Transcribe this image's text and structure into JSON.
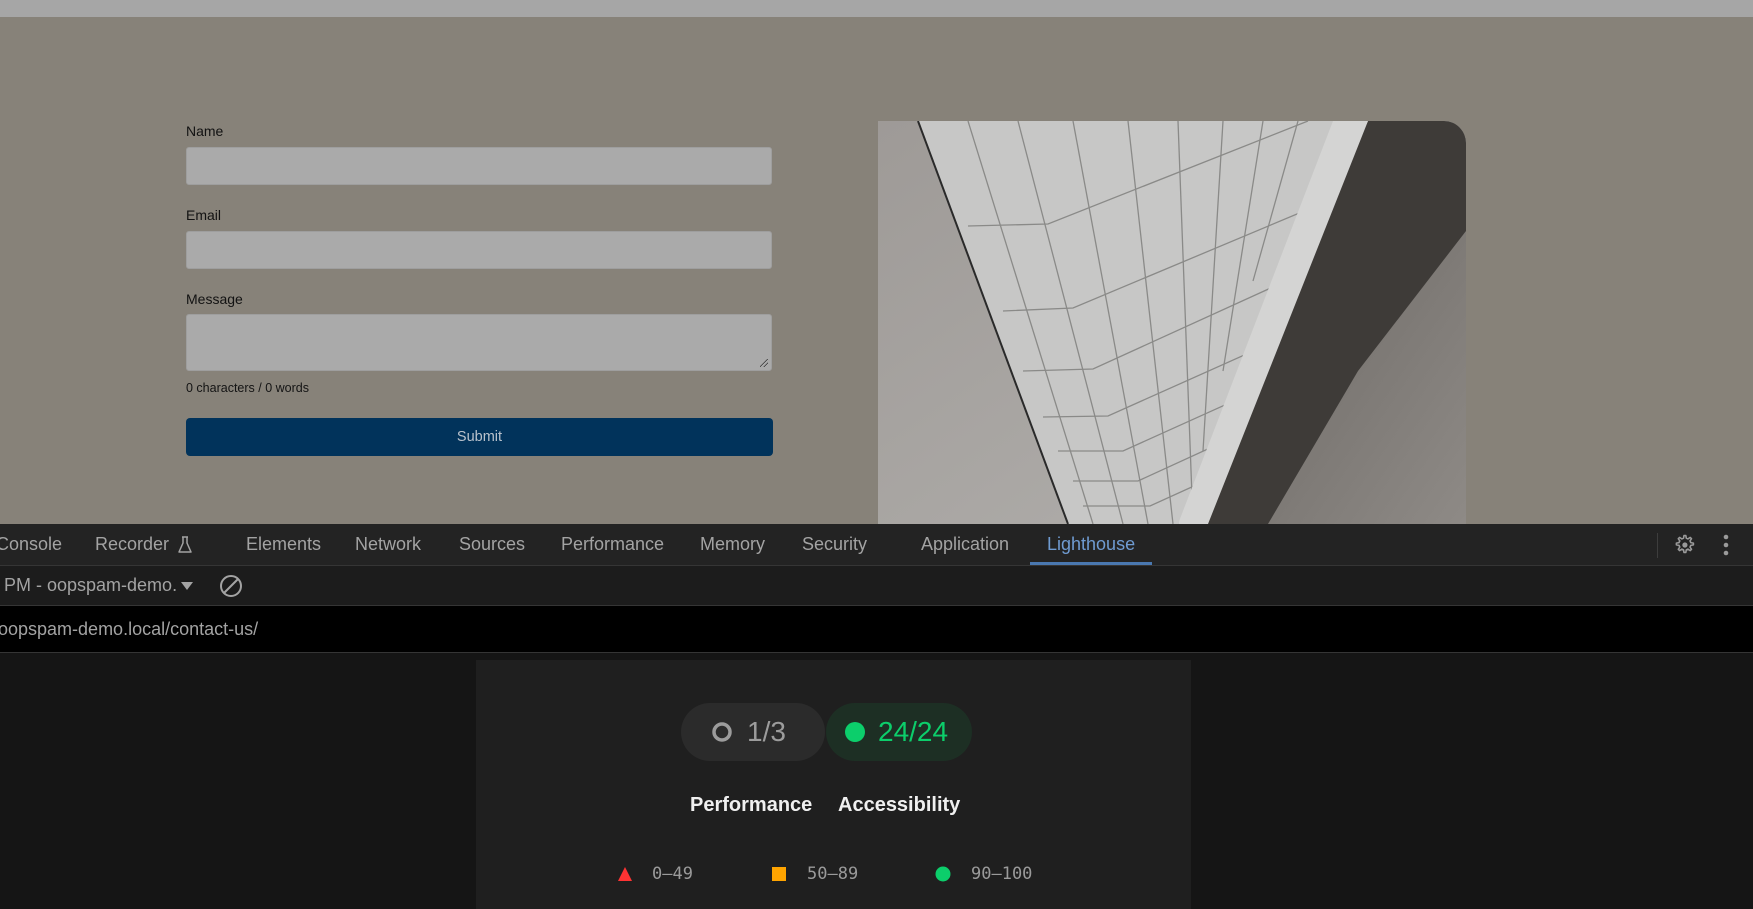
{
  "page": {
    "form": {
      "name_label": "Name",
      "name_value": "",
      "email_label": "Email",
      "email_value": "",
      "message_label": "Message",
      "message_value": "",
      "counter": "0 characters / 0 words",
      "submit_label": "Submit"
    },
    "image_alt": "Architectural skylight ceiling photo"
  },
  "devtools": {
    "tabs": [
      {
        "label": "Console"
      },
      {
        "label": "Recorder"
      },
      {
        "label": "Elements"
      },
      {
        "label": "Network"
      },
      {
        "label": "Sources"
      },
      {
        "label": "Performance"
      },
      {
        "label": "Memory"
      },
      {
        "label": "Security"
      },
      {
        "label": "Application"
      },
      {
        "label": "Lighthouse",
        "active": true
      }
    ],
    "toolbar": {
      "report_select": "PM - oopspam-demo.",
      "clear_icon": "block-icon"
    },
    "url": "oopspam-demo.local/contact-us/",
    "report": {
      "categories": [
        {
          "label": "Performance",
          "score": "1/3",
          "status": "neutral"
        },
        {
          "label": "Accessibility",
          "score": "24/24",
          "status": "pass"
        }
      ],
      "legend": [
        {
          "range": "0–49",
          "shape": "triangle",
          "color": "#ff3333"
        },
        {
          "range": "50–89",
          "shape": "square",
          "color": "#ffa400"
        },
        {
          "range": "90–100",
          "shape": "circle",
          "color": "#0cce6b"
        }
      ]
    }
  }
}
